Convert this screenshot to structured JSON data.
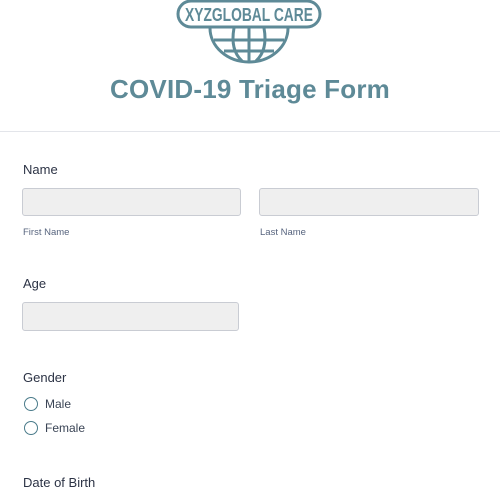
{
  "brand": {
    "logo_text": "XYZGLOBAL CARE"
  },
  "form": {
    "title": "COVID-19 Triage Form",
    "name": {
      "label": "Name",
      "first_name_value": "",
      "last_name_value": "",
      "first_sublabel": "First Name",
      "last_sublabel": "Last Name"
    },
    "age": {
      "label": "Age",
      "value": ""
    },
    "gender": {
      "label": "Gender",
      "options": [
        "Male",
        "Female"
      ]
    },
    "dob": {
      "label": "Date of Birth"
    }
  },
  "colors": {
    "brand": "#5e8a97",
    "radio_border": "#4a7b8a",
    "input_bg": "#efefef"
  }
}
